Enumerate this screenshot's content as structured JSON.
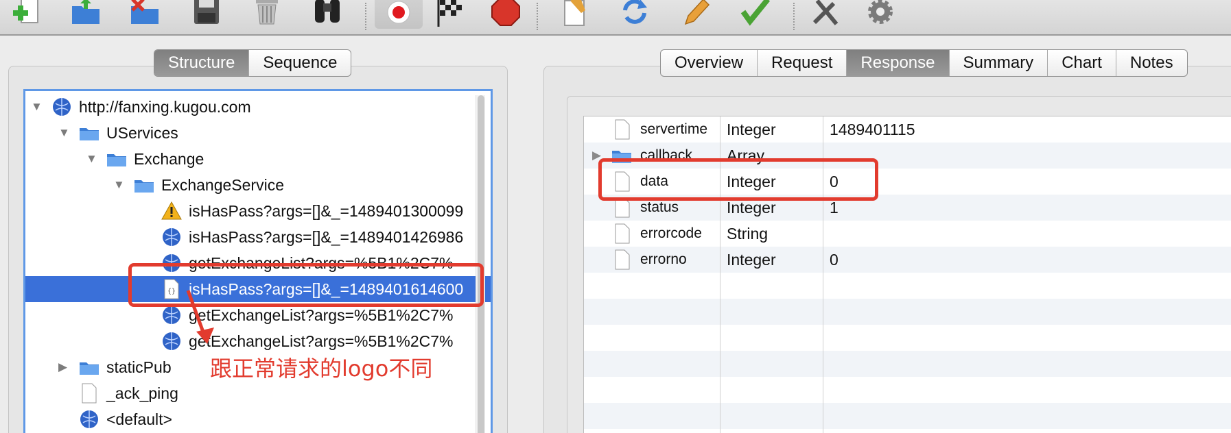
{
  "toolbar": {
    "buttons": [
      {
        "name": "add-icon",
        "color": "#3cae3a"
      },
      {
        "name": "open-folder-icon",
        "color": "#3d7fd6"
      },
      {
        "name": "delete-folder-icon",
        "color": "#d8352a"
      },
      {
        "name": "save-icon",
        "color": "#555555"
      },
      {
        "name": "trash-icon",
        "color": "#9a9a9a"
      },
      {
        "name": "binoculars-icon",
        "color": "#222222"
      },
      {
        "name": "record-icon",
        "color": "#e0191f"
      },
      {
        "name": "checkered-flag-icon",
        "color": "#222222"
      },
      {
        "name": "stop-icon",
        "color": "#d8352a"
      },
      {
        "name": "edit-document-icon",
        "color": "#e3a23a"
      },
      {
        "name": "refresh-icon",
        "color": "#3d7fd6"
      },
      {
        "name": "pencil-icon",
        "color": "#e8a03a"
      },
      {
        "name": "check-icon",
        "color": "#4aa334"
      },
      {
        "name": "tools-icon",
        "color": "#555555"
      },
      {
        "name": "settings-gear-icon",
        "color": "#7b7b7b"
      }
    ]
  },
  "left_tabs": {
    "structure": "Structure",
    "sequence": "Sequence",
    "selected": "Structure"
  },
  "tree": {
    "items": [
      {
        "label": "http://fanxing.kugou.com",
        "icon": "globe-icon",
        "expanded": true
      },
      {
        "label": "UServices",
        "icon": "folder-icon",
        "expanded": true
      },
      {
        "label": "Exchange",
        "icon": "folder-icon",
        "expanded": true
      },
      {
        "label": "ExchangeService",
        "icon": "folder-icon",
        "expanded": true
      },
      {
        "label": "isHasPass?args=[]&_=1489401300099",
        "icon": "warning-icon"
      },
      {
        "label": "isHasPass?args=[]&_=1489401426986",
        "icon": "globe-icon"
      },
      {
        "label": "getExchangeList?args=%5B1%2C7%",
        "icon": "globe-icon"
      },
      {
        "label": "isHasPass?args=[]&_=1489401614600",
        "icon": "json-file-icon",
        "selected": true
      },
      {
        "label": "getExchangeList?args=%5B1%2C7%",
        "icon": "globe-icon"
      },
      {
        "label": "getExchangeList?args=%5B1%2C7%",
        "icon": "globe-icon"
      },
      {
        "label": "staticPub",
        "icon": "folder-icon",
        "expanded": false
      },
      {
        "label": "_ack_ping",
        "icon": "file-icon"
      },
      {
        "label": "<default>",
        "icon": "globe-icon"
      }
    ]
  },
  "right_tabs": {
    "overview": "Overview",
    "request": "Request",
    "response": "Response",
    "summary": "Summary",
    "chart": "Chart",
    "notes": "Notes",
    "selected": "Response"
  },
  "response_table": {
    "rows": [
      {
        "name": "servertime",
        "type": "Integer",
        "value": "1489401115"
      },
      {
        "name": "callback",
        "type": "Array",
        "value": ""
      },
      {
        "name": "data",
        "type": "Integer",
        "value": "0"
      },
      {
        "name": "status",
        "type": "Integer",
        "value": "1"
      },
      {
        "name": "errorcode",
        "type": "String",
        "value": ""
      },
      {
        "name": "errorno",
        "type": "Integer",
        "value": "0"
      }
    ]
  },
  "annotation": {
    "text": "跟正常请求的logo不同",
    "color": "#e23b2e"
  },
  "colors": {
    "selection": "#3a70d9",
    "focus_ring": "#5f98e6"
  }
}
